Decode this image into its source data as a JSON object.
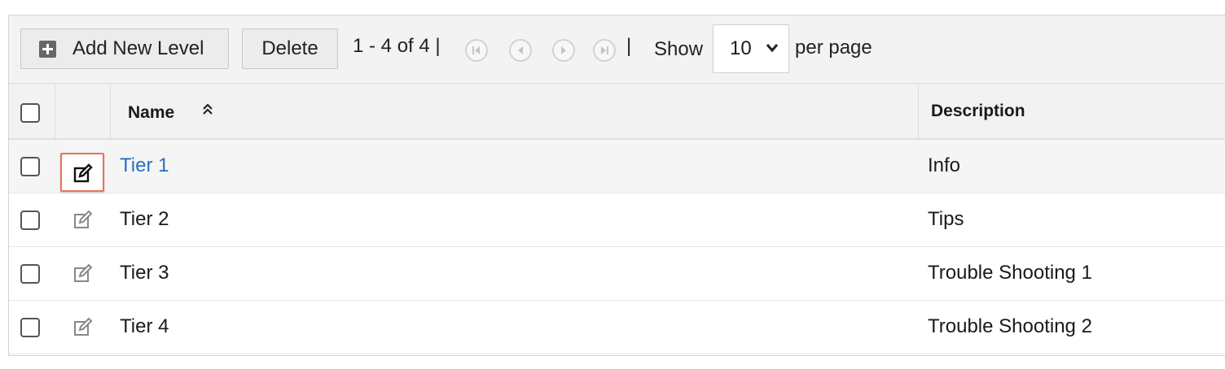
{
  "toolbar": {
    "add_label": "Add New Level",
    "delete_label": "Delete",
    "range_text": "1 - 4 of 4 |",
    "separator": "|",
    "show_label": "Show",
    "per_page_value": "10",
    "per_page_label": "per page",
    "nav_icons": [
      "first-page-icon",
      "prev-page-icon",
      "next-page-icon",
      "last-page-icon"
    ]
  },
  "table": {
    "headers": {
      "name": "Name",
      "description": "Description"
    },
    "rows": [
      {
        "name": "Tier 1",
        "description": "Info"
      },
      {
        "name": "Tier 2",
        "description": "Tips"
      },
      {
        "name": "Tier 3",
        "description": "Trouble Shooting 1"
      },
      {
        "name": "Tier 4",
        "description": "Trouble Shooting 2"
      }
    ]
  },
  "colors": {
    "link": "#2a6fbf",
    "focus_outline": "#e8735f"
  }
}
